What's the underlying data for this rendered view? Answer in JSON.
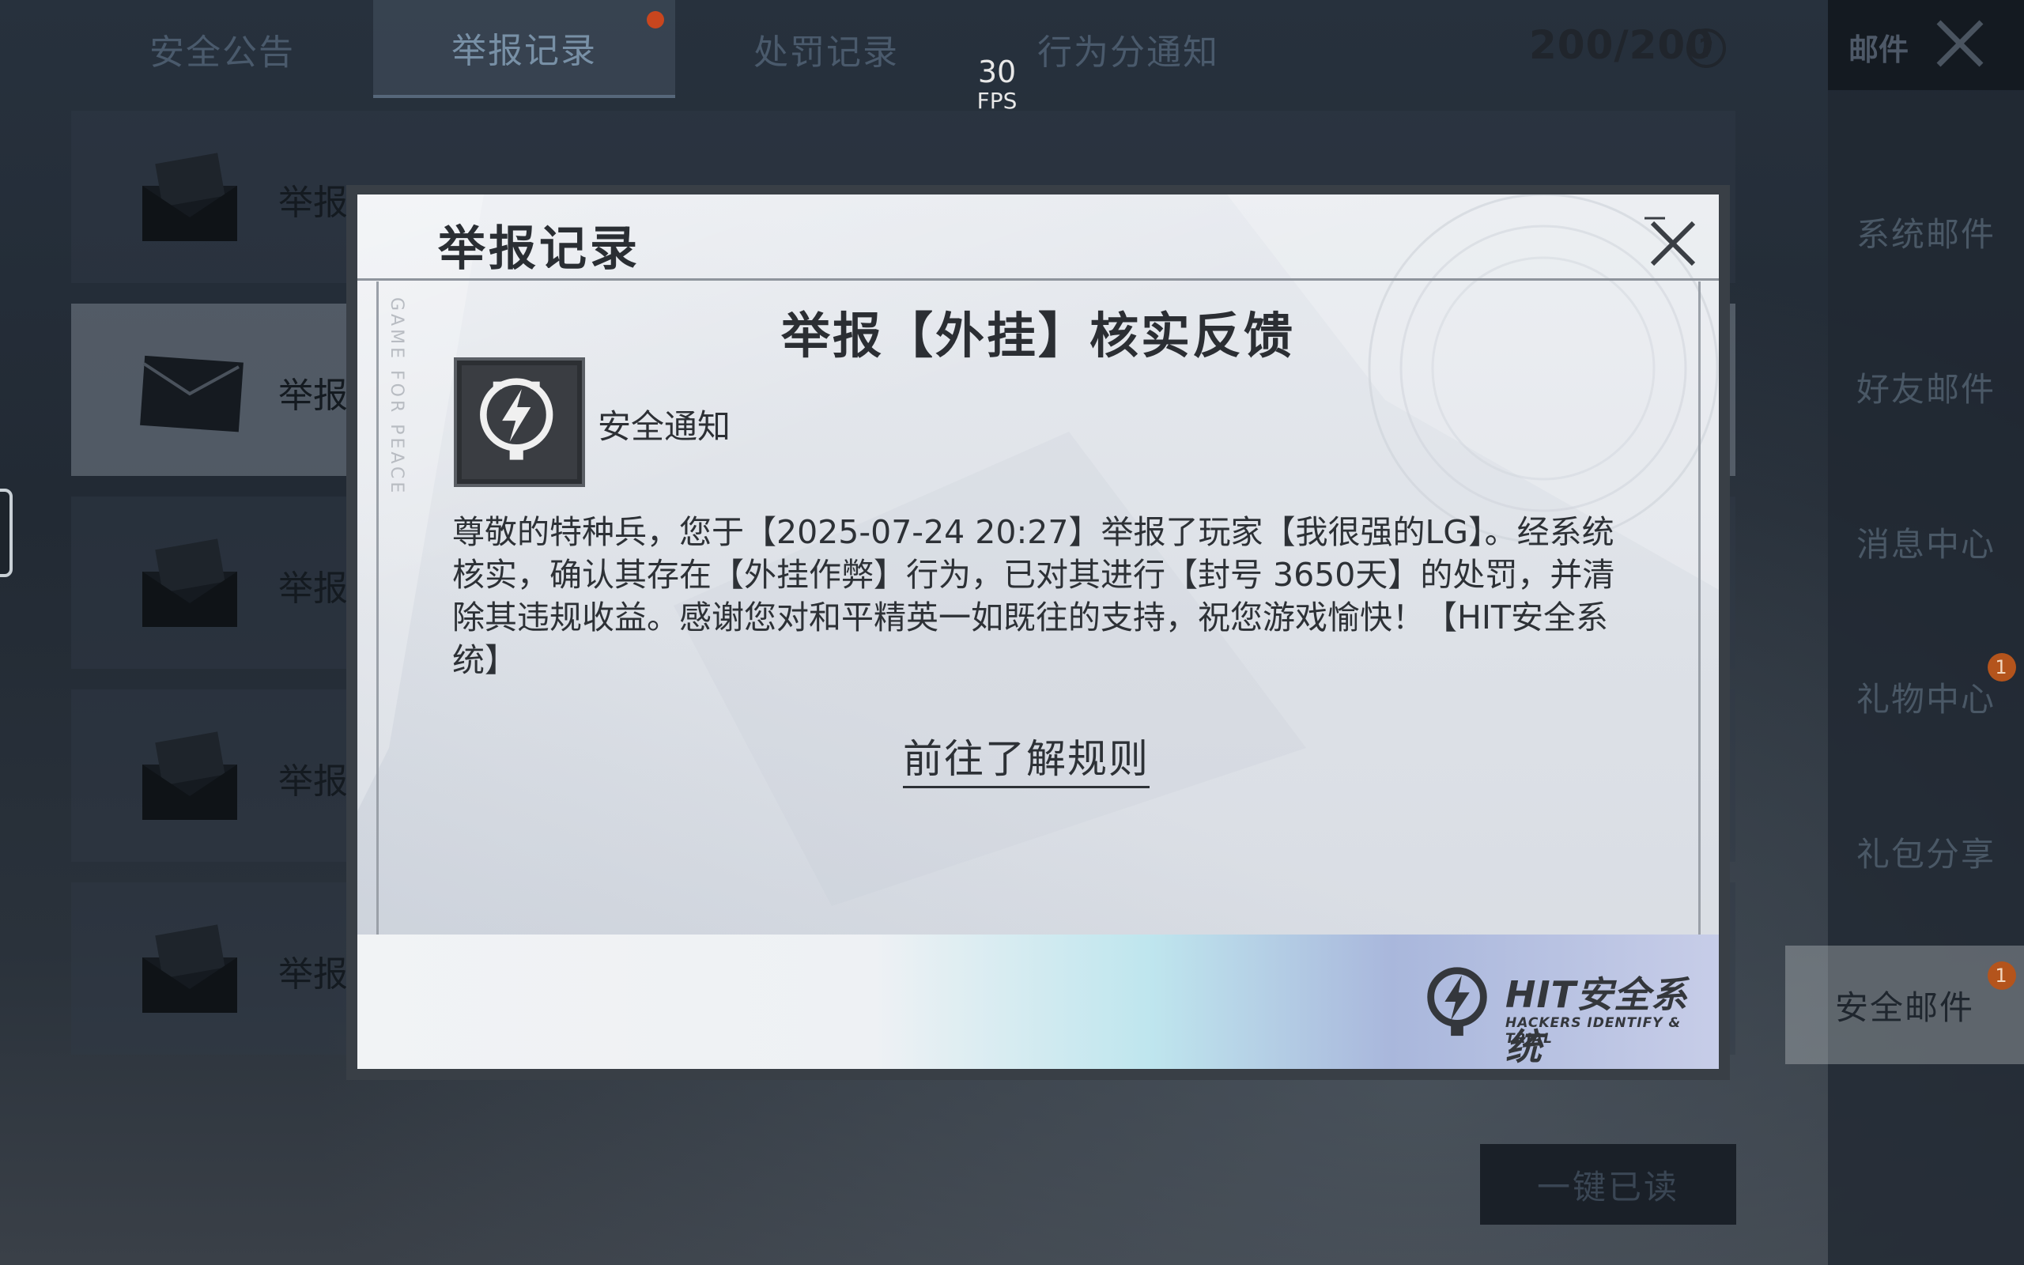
{
  "top_tabs": [
    {
      "label": "安全公告"
    },
    {
      "label": "举报记录"
    },
    {
      "label": "处罚记录"
    },
    {
      "label": "行为分通知"
    }
  ],
  "counter": "200/200",
  "fps": {
    "value": "30",
    "label": "FPS"
  },
  "sidebar": {
    "title": "邮件",
    "items": [
      {
        "label": "系统邮件"
      },
      {
        "label": "好友邮件"
      },
      {
        "label": "消息中心"
      },
      {
        "label": "礼物中心",
        "badge": "1"
      },
      {
        "label": "礼包分享"
      },
      {
        "label": "安全邮件",
        "badge": "1"
      }
    ]
  },
  "mail_list": {
    "rows": [
      {
        "label": "举报"
      },
      {
        "label": "举报"
      },
      {
        "label": "举报"
      },
      {
        "label": "举报"
      },
      {
        "label": "举报"
      }
    ],
    "mark_all_read": "一键已读"
  },
  "dialog": {
    "title": "举报记录",
    "side_tag": "GAME FOR PEACE",
    "content_title": "举报【外挂】核实反馈",
    "notice_label": "安全通知",
    "message": "尊敬的特种兵，您于【2025-07-24 20:27】举报了玩家【我很强的LG】。经系统核实，确认其存在【外挂作弊】行为，已对其进行【封号 3650天】的处罚，并清除其违规收益。感谢您对和平精英一如既往的支持，祝您游戏愉快！【HIT安全系统】",
    "rules_link": "前往了解规则",
    "brand_main": "HIT安全系统",
    "brand_sub": "HACKERS IDENTIFY & TRIAL"
  },
  "colors": {
    "badge": "#b4541c",
    "dialog_bg": "#e2e5ea",
    "text_dark": "#2d3136"
  },
  "icons": [
    "close-icon",
    "help-icon",
    "envelope-icon",
    "lightning-shield-icon"
  ]
}
